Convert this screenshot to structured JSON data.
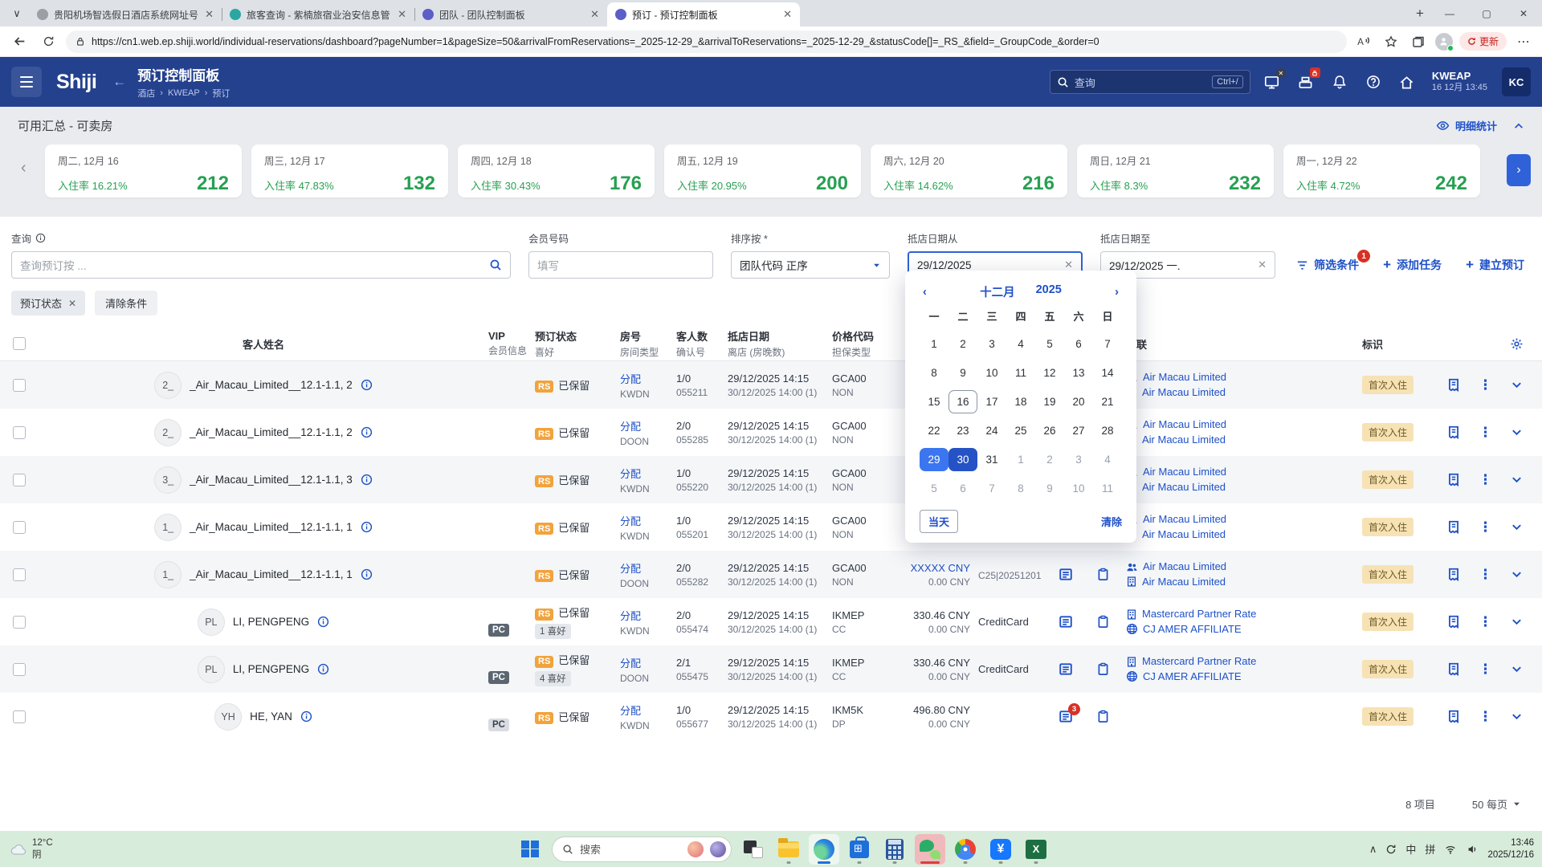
{
  "browser": {
    "tabs": [
      {
        "title": "贵阳机场智选假日酒店系统网址号",
        "icon": "globe",
        "active": false
      },
      {
        "title": "旅客查询 - 紫楠旅宿业治安信息管",
        "icon": "teal",
        "active": false
      },
      {
        "title": "团队 - 团队控制面板",
        "icon": "purple",
        "active": false
      },
      {
        "title": "预订 - 预订控制面板",
        "icon": "purple",
        "active": true
      }
    ],
    "url": "https://cn1.web.ep.shiji.world/individual-reservations/dashboard?pageNumber=1&pageSize=50&arrivalFromReservations=_2025-12-29_&arrivalToReservations=_2025-12-29_&statusCode[]=_RS_&field=_GroupCode_&order=0",
    "update_label": "更新"
  },
  "header": {
    "logo": "Shiji",
    "title": "预订控制面板",
    "breadcrumb": [
      "酒店",
      "KWEAP",
      "预订"
    ],
    "search_placeholder": "查询",
    "search_shortcut": "Ctrl+/",
    "property": "KWEAP",
    "datetime": "16 12月 13:45",
    "user_initials": "KC"
  },
  "summary": {
    "title": "可用汇总 - 可卖房",
    "detail_link": "明细统计",
    "occ_label": "入住率",
    "cards": [
      {
        "date": "周二, 12月 16",
        "occ": "16.21%",
        "avail": "212"
      },
      {
        "date": "周三, 12月 17",
        "occ": "47.83%",
        "avail": "132"
      },
      {
        "date": "周四, 12月 18",
        "occ": "30.43%",
        "avail": "176"
      },
      {
        "date": "周五, 12月 19",
        "occ": "20.95%",
        "avail": "200"
      },
      {
        "date": "周六, 12月 20",
        "occ": "14.62%",
        "avail": "216"
      },
      {
        "date": "周日, 12月 21",
        "occ": "8.3%",
        "avail": "232"
      },
      {
        "date": "周一, 12月 22",
        "occ": "4.72%",
        "avail": "242"
      }
    ]
  },
  "filters": {
    "query_label": "查询",
    "query_placeholder": "查询预订按 ...",
    "member_label": "会员号码",
    "member_placeholder": "填写",
    "sort_label": "排序按 *",
    "sort_value": "团队代码 正序",
    "date_from_label": "抵店日期从",
    "date_from_value": "29/12/2025",
    "date_to_label": "抵店日期至",
    "date_to_value": "29/12/2025 一.",
    "filter_button": "筛选条件",
    "filter_badge": "1",
    "add_task_button": "添加任务",
    "create_button": "建立预订",
    "chip_label": "预订状态",
    "clear_chip_label": "清除条件"
  },
  "datepicker": {
    "month": "十二月",
    "year": "2025",
    "weekdays": [
      "一",
      "二",
      "三",
      "四",
      "五",
      "六",
      "日"
    ],
    "weeks": [
      [
        {
          "d": "1"
        },
        {
          "d": "2"
        },
        {
          "d": "3"
        },
        {
          "d": "4"
        },
        {
          "d": "5"
        },
        {
          "d": "6"
        },
        {
          "d": "7"
        }
      ],
      [
        {
          "d": "8"
        },
        {
          "d": "9"
        },
        {
          "d": "10"
        },
        {
          "d": "11"
        },
        {
          "d": "12"
        },
        {
          "d": "13"
        },
        {
          "d": "14"
        }
      ],
      [
        {
          "d": "15"
        },
        {
          "d": "16",
          "s": "today"
        },
        {
          "d": "17"
        },
        {
          "d": "18"
        },
        {
          "d": "19"
        },
        {
          "d": "20"
        },
        {
          "d": "21"
        }
      ],
      [
        {
          "d": "22"
        },
        {
          "d": "23"
        },
        {
          "d": "24"
        },
        {
          "d": "25"
        },
        {
          "d": "26"
        },
        {
          "d": "27"
        },
        {
          "d": "28"
        }
      ],
      [
        {
          "d": "29",
          "s": "sel1"
        },
        {
          "d": "30",
          "s": "sel2"
        },
        {
          "d": "31"
        },
        {
          "d": "1",
          "s": "muted"
        },
        {
          "d": "2",
          "s": "muted"
        },
        {
          "d": "3",
          "s": "muted"
        },
        {
          "d": "4",
          "s": "muted"
        }
      ],
      [
        {
          "d": "5",
          "s": "muted"
        },
        {
          "d": "6",
          "s": "muted"
        },
        {
          "d": "7",
          "s": "muted"
        },
        {
          "d": "8",
          "s": "muted"
        },
        {
          "d": "9",
          "s": "muted"
        },
        {
          "d": "10",
          "s": "muted"
        },
        {
          "d": "11",
          "s": "muted"
        }
      ]
    ],
    "today_button": "当天",
    "clear_button": "清除"
  },
  "table": {
    "headers": {
      "guest": "客人姓名",
      "vip1": "VIP",
      "vip2": "会员信息",
      "status1": "预订状态",
      "status2": "喜好",
      "room1": "房号",
      "room2": "房间类型",
      "guests1": "客人数",
      "guests2": "确认号",
      "dates1": "抵店日期",
      "dates2": "离店 (房晚数)",
      "rate1": "价格代码",
      "rate2": "担保类型",
      "links": "关联",
      "tag": "标识"
    },
    "rows": [
      {
        "avatar": "2_",
        "name": "_Air_Macau_Limited__12.1-1.1, 2",
        "vip": "",
        "status_code": "RS",
        "status": "已保留",
        "pref": "",
        "assign": "分配",
        "room_type": "KWDN",
        "guests": "1/0",
        "confirm_no": "055211",
        "arrival": "29/12/2025 14:15",
        "departure": "30/12/2025 14:00 (1)",
        "rate_code": "GCA00",
        "guarantee": "NON",
        "price": "",
        "deposit": "",
        "payment": "",
        "note_badge": "",
        "show_docs": false,
        "links": [
          [
            "people",
            "Air Macau Limited"
          ],
          [
            "building",
            "Air Macau Limited"
          ]
        ],
        "tag": "首次入住"
      },
      {
        "avatar": "2_",
        "name": "_Air_Macau_Limited__12.1-1.1, 2",
        "vip": "",
        "status_code": "RS",
        "status": "已保留",
        "pref": "",
        "assign": "分配",
        "room_type": "DOON",
        "guests": "2/0",
        "confirm_no": "055285",
        "arrival": "29/12/2025 14:15",
        "departure": "30/12/2025 14:00 (1)",
        "rate_code": "GCA00",
        "guarantee": "NON",
        "price": "",
        "deposit": "",
        "payment": "",
        "note_badge": "",
        "show_docs": false,
        "links": [
          [
            "people",
            "Air Macau Limited"
          ],
          [
            "building",
            "Air Macau Limited"
          ]
        ],
        "tag": "首次入住"
      },
      {
        "avatar": "3_",
        "name": "_Air_Macau_Limited__12.1-1.1, 3",
        "vip": "",
        "status_code": "RS",
        "status": "已保留",
        "pref": "",
        "assign": "分配",
        "room_type": "KWDN",
        "guests": "1/0",
        "confirm_no": "055220",
        "arrival": "29/12/2025 14:15",
        "departure": "30/12/2025 14:00 (1)",
        "rate_code": "GCA00",
        "guarantee": "NON",
        "price": "",
        "deposit": "",
        "payment": "",
        "note_badge": "",
        "show_docs": false,
        "links": [
          [
            "people",
            "Air Macau Limited"
          ],
          [
            "building",
            "Air Macau Limited"
          ]
        ],
        "tag": "首次入住"
      },
      {
        "avatar": "1_",
        "name": "_Air_Macau_Limited__12.1-1.1, 1",
        "vip": "",
        "status_code": "RS",
        "status": "已保留",
        "pref": "",
        "assign": "分配",
        "room_type": "KWDN",
        "guests": "1/0",
        "confirm_no": "055201",
        "arrival": "29/12/2025 14:15",
        "departure": "30/12/2025 14:00 (1)",
        "rate_code": "GCA00",
        "guarantee": "NON",
        "price": "",
        "deposit": "",
        "payment": "",
        "note_badge": "",
        "show_docs": false,
        "links": [
          [
            "people",
            "Air Macau Limited"
          ],
          [
            "building",
            "Air Macau Limited"
          ]
        ],
        "tag": "首次入住"
      },
      {
        "avatar": "1_",
        "name": "_Air_Macau_Limited__12.1-1.1, 1",
        "vip": "",
        "status_code": "RS",
        "status": "已保留",
        "pref": "",
        "assign": "分配",
        "room_type": "DOON",
        "guests": "2/0",
        "confirm_no": "055282",
        "arrival": "29/12/2025 14:15",
        "departure": "30/12/2025 14:00 (1)",
        "rate_code": "GCA00",
        "guarantee": "NON",
        "price": "XXXXX CNY",
        "price_masked": true,
        "deposit": "0.00 CNY",
        "payment": "C25|20251201",
        "payment_muted": true,
        "note_badge": "",
        "show_docs": true,
        "links": [
          [
            "people",
            "Air Macau Limited"
          ],
          [
            "building",
            "Air Macau Limited"
          ]
        ],
        "tag": "首次入住"
      },
      {
        "avatar": "PL",
        "name": "LI, PENGPENG",
        "vip": "PC",
        "vip_dark": true,
        "status_code": "RS",
        "status": "已保留",
        "pref": "1 喜好",
        "assign": "分配",
        "room_type": "KWDN",
        "guests": "2/0",
        "confirm_no": "055474",
        "arrival": "29/12/2025 14:15",
        "departure": "30/12/2025 14:00 (1)",
        "rate_code": "IKMEP",
        "guarantee": "CC",
        "price": "330.46 CNY",
        "deposit": "0.00 CNY",
        "payment": "CreditCard",
        "note_badge": "",
        "show_docs": true,
        "links": [
          [
            "building",
            "Mastercard Partner Rate"
          ],
          [
            "globe",
            "CJ AMER AFFILIATE"
          ]
        ],
        "tag": "首次入住"
      },
      {
        "avatar": "PL",
        "name": "LI, PENGPENG",
        "vip": "PC",
        "vip_dark": true,
        "status_code": "RS",
        "status": "已保留",
        "pref": "4 喜好",
        "assign": "分配",
        "room_type": "DOON",
        "guests": "2/1",
        "confirm_no": "055475",
        "arrival": "29/12/2025 14:15",
        "departure": "30/12/2025 14:00 (1)",
        "rate_code": "IKMEP",
        "guarantee": "CC",
        "price": "330.46 CNY",
        "deposit": "0.00 CNY",
        "payment": "CreditCard",
        "note_badge": "",
        "show_docs": true,
        "links": [
          [
            "building",
            "Mastercard Partner Rate"
          ],
          [
            "globe",
            "CJ AMER AFFILIATE"
          ]
        ],
        "tag": "首次入住"
      },
      {
        "avatar": "YH",
        "name": "HE, YAN",
        "vip": "PC",
        "vip_dark": false,
        "status_code": "RS",
        "status": "已保留",
        "pref": "",
        "assign": "分配",
        "room_type": "KWDN",
        "guests": "1/0",
        "confirm_no": "055677",
        "arrival": "29/12/2025 14:15",
        "departure": "30/12/2025 14:00 (1)",
        "rate_code": "IKM5K",
        "guarantee": "DP",
        "price": "496.80 CNY",
        "deposit": "0.00 CNY",
        "payment": "",
        "note_badge": "3",
        "show_docs": true,
        "links": [],
        "tag": "首次入住"
      }
    ]
  },
  "pagination": {
    "items": "8 项目",
    "per_page": "50 每页"
  },
  "taskbar": {
    "weather_temp": "12°C",
    "weather_cond": "阴",
    "search_placeholder": "搜索",
    "ime": "中",
    "ime2": "拼",
    "time": "13:46",
    "date": "2025/12/16"
  },
  "colors": {
    "accent": "#1e50c8",
    "header": "#24418e",
    "green": "#27a052",
    "sel1": "#3b76f0",
    "sel2": "#2553c5"
  }
}
